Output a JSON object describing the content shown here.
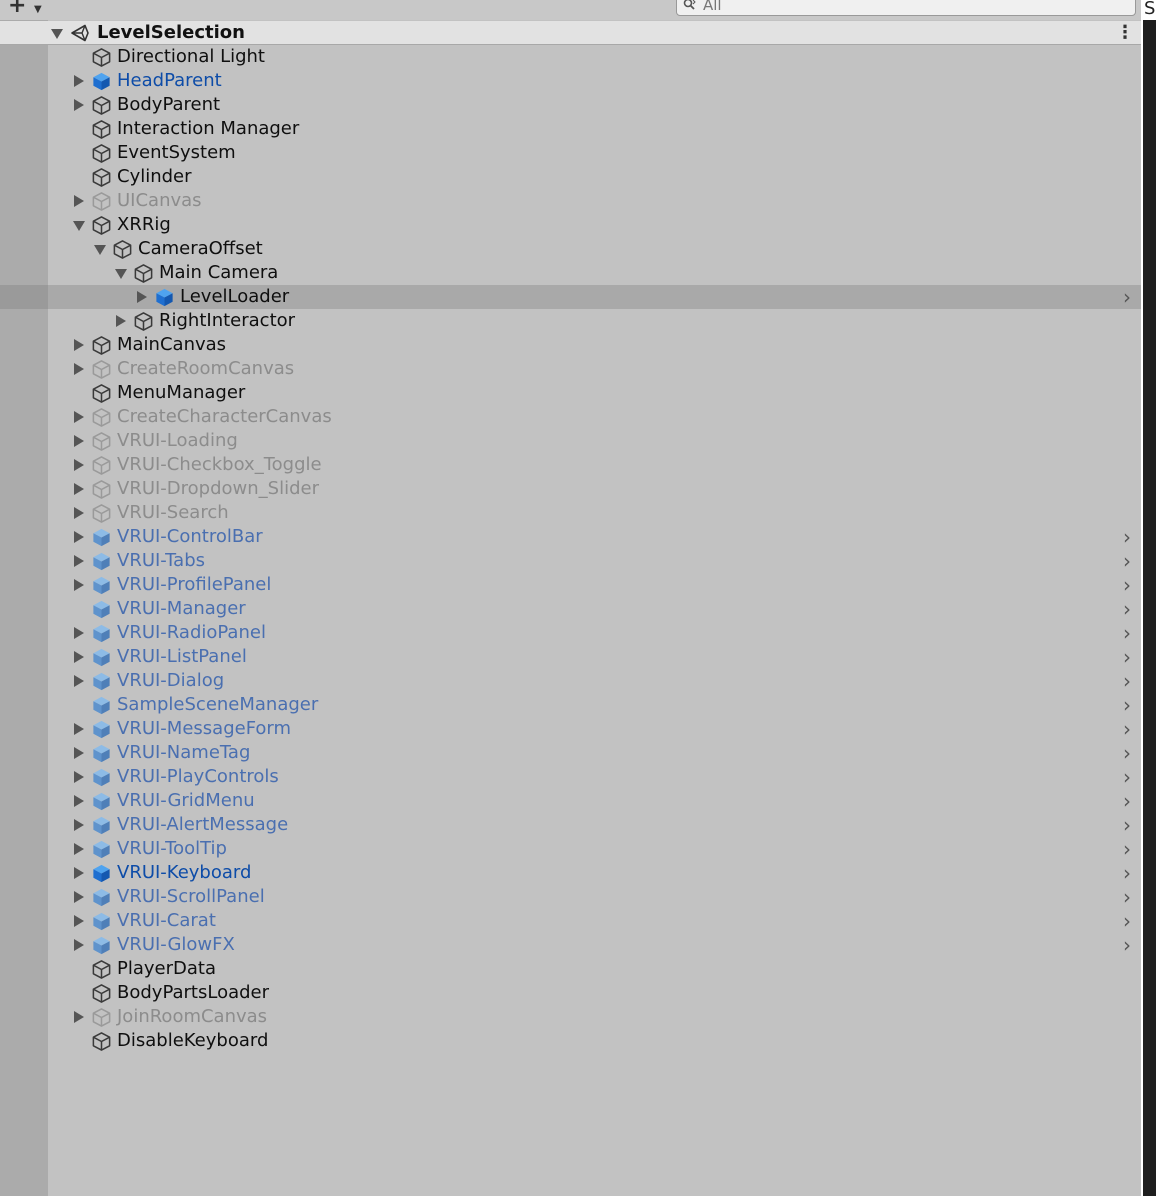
{
  "toolbar": {
    "add_icon": "plus-icon",
    "search": {
      "value": "All",
      "icon": "search-icon"
    }
  },
  "scene": {
    "name": "LevelSelection",
    "menu_glyph": "⋮"
  },
  "edge_letter": "S",
  "colors": {
    "normal": "#0f0f0f",
    "dim": "#8c8c8c",
    "prefab": "#4a6fb0",
    "prefab_strong": "#0d4ca8",
    "selected_row": "#a9a9a9"
  },
  "hierarchy": [
    {
      "label": "Directional Light",
      "depth": 0,
      "fold": "none",
      "icon": "gameobject",
      "style": "normal",
      "chevron": false
    },
    {
      "label": "HeadParent",
      "depth": 0,
      "fold": "collapsed",
      "icon": "prefab-strong",
      "style": "prefab_strong",
      "chevron": false
    },
    {
      "label": "BodyParent",
      "depth": 0,
      "fold": "collapsed",
      "icon": "gameobject",
      "style": "normal",
      "chevron": false
    },
    {
      "label": "Interaction Manager",
      "depth": 0,
      "fold": "none",
      "icon": "gameobject",
      "style": "normal",
      "chevron": false
    },
    {
      "label": "EventSystem",
      "depth": 0,
      "fold": "none",
      "icon": "gameobject",
      "style": "normal",
      "chevron": false
    },
    {
      "label": "Cylinder",
      "depth": 0,
      "fold": "none",
      "icon": "gameobject",
      "style": "normal",
      "chevron": false
    },
    {
      "label": "UICanvas",
      "depth": 0,
      "fold": "collapsed",
      "icon": "gameobject-dim",
      "style": "dim",
      "chevron": false
    },
    {
      "label": "XRRig",
      "depth": 0,
      "fold": "expanded",
      "icon": "gameobject",
      "style": "normal",
      "chevron": false
    },
    {
      "label": "CameraOffset",
      "depth": 1,
      "fold": "expanded",
      "icon": "gameobject",
      "style": "normal",
      "chevron": false
    },
    {
      "label": "Main Camera",
      "depth": 2,
      "fold": "expanded",
      "icon": "gameobject",
      "style": "normal",
      "chevron": false
    },
    {
      "label": "LevelLoader",
      "depth": 3,
      "fold": "collapsed",
      "icon": "prefab-strong",
      "style": "normal",
      "chevron": true,
      "selected": true
    },
    {
      "label": "RightInteractor",
      "depth": 2,
      "fold": "collapsed",
      "icon": "gameobject",
      "style": "normal",
      "chevron": false
    },
    {
      "label": "MainCanvas",
      "depth": 0,
      "fold": "collapsed",
      "icon": "gameobject",
      "style": "normal",
      "chevron": false
    },
    {
      "label": "CreateRoomCanvas",
      "depth": 0,
      "fold": "collapsed",
      "icon": "gameobject-dim",
      "style": "dim",
      "chevron": false
    },
    {
      "label": "MenuManager",
      "depth": 0,
      "fold": "none",
      "icon": "gameobject",
      "style": "normal",
      "chevron": false
    },
    {
      "label": "CreateCharacterCanvas",
      "depth": 0,
      "fold": "collapsed",
      "icon": "gameobject-dim",
      "style": "dim",
      "chevron": false
    },
    {
      "label": "VRUI-Loading",
      "depth": 0,
      "fold": "collapsed",
      "icon": "gameobject-dim",
      "style": "dim",
      "chevron": false
    },
    {
      "label": "VRUI-Checkbox_Toggle",
      "depth": 0,
      "fold": "collapsed",
      "icon": "gameobject-dim",
      "style": "dim",
      "chevron": false
    },
    {
      "label": "VRUI-Dropdown_Slider",
      "depth": 0,
      "fold": "collapsed",
      "icon": "gameobject-dim",
      "style": "dim",
      "chevron": false
    },
    {
      "label": "VRUI-Search",
      "depth": 0,
      "fold": "collapsed",
      "icon": "gameobject-dim",
      "style": "dim",
      "chevron": false
    },
    {
      "label": "VRUI-ControlBar",
      "depth": 0,
      "fold": "collapsed",
      "icon": "prefab",
      "style": "prefab",
      "chevron": true
    },
    {
      "label": "VRUI-Tabs",
      "depth": 0,
      "fold": "collapsed",
      "icon": "prefab",
      "style": "prefab",
      "chevron": true
    },
    {
      "label": "VRUI-ProfilePanel",
      "depth": 0,
      "fold": "collapsed",
      "icon": "prefab",
      "style": "prefab",
      "chevron": true
    },
    {
      "label": "VRUI-Manager",
      "depth": 0,
      "fold": "none",
      "icon": "prefab",
      "style": "prefab",
      "chevron": true
    },
    {
      "label": "VRUI-RadioPanel",
      "depth": 0,
      "fold": "collapsed",
      "icon": "prefab",
      "style": "prefab",
      "chevron": true
    },
    {
      "label": "VRUI-ListPanel",
      "depth": 0,
      "fold": "collapsed",
      "icon": "prefab",
      "style": "prefab",
      "chevron": true
    },
    {
      "label": "VRUI-Dialog",
      "depth": 0,
      "fold": "collapsed",
      "icon": "prefab",
      "style": "prefab",
      "chevron": true
    },
    {
      "label": "SampleSceneManager",
      "depth": 0,
      "fold": "none",
      "icon": "prefab",
      "style": "prefab",
      "chevron": true
    },
    {
      "label": "VRUI-MessageForm",
      "depth": 0,
      "fold": "collapsed",
      "icon": "prefab",
      "style": "prefab",
      "chevron": true
    },
    {
      "label": "VRUI-NameTag",
      "depth": 0,
      "fold": "collapsed",
      "icon": "prefab",
      "style": "prefab",
      "chevron": true
    },
    {
      "label": "VRUI-PlayControls",
      "depth": 0,
      "fold": "collapsed",
      "icon": "prefab",
      "style": "prefab",
      "chevron": true
    },
    {
      "label": "VRUI-GridMenu",
      "depth": 0,
      "fold": "collapsed",
      "icon": "prefab",
      "style": "prefab",
      "chevron": true
    },
    {
      "label": "VRUI-AlertMessage",
      "depth": 0,
      "fold": "collapsed",
      "icon": "prefab",
      "style": "prefab",
      "chevron": true
    },
    {
      "label": "VRUI-ToolTip",
      "depth": 0,
      "fold": "collapsed",
      "icon": "prefab",
      "style": "prefab",
      "chevron": true
    },
    {
      "label": "VRUI-Keyboard",
      "depth": 0,
      "fold": "collapsed",
      "icon": "prefab-strong",
      "style": "prefab_strong",
      "chevron": true
    },
    {
      "label": "VRUI-ScrollPanel",
      "depth": 0,
      "fold": "collapsed",
      "icon": "prefab",
      "style": "prefab",
      "chevron": true
    },
    {
      "label": "VRUI-Carat",
      "depth": 0,
      "fold": "collapsed",
      "icon": "prefab",
      "style": "prefab",
      "chevron": true
    },
    {
      "label": "VRUI-GlowFX",
      "depth": 0,
      "fold": "collapsed",
      "icon": "prefab",
      "style": "prefab",
      "chevron": true
    },
    {
      "label": "PlayerData",
      "depth": 0,
      "fold": "none",
      "icon": "gameobject",
      "style": "normal",
      "chevron": false
    },
    {
      "label": "BodyPartsLoader",
      "depth": 0,
      "fold": "none",
      "icon": "gameobject",
      "style": "normal",
      "chevron": false
    },
    {
      "label": "JoinRoomCanvas",
      "depth": 0,
      "fold": "collapsed",
      "icon": "gameobject-dim",
      "style": "dim",
      "chevron": false
    },
    {
      "label": "DisableKeyboard",
      "depth": 0,
      "fold": "none",
      "icon": "gameobject",
      "style": "normal",
      "chevron": false
    }
  ]
}
